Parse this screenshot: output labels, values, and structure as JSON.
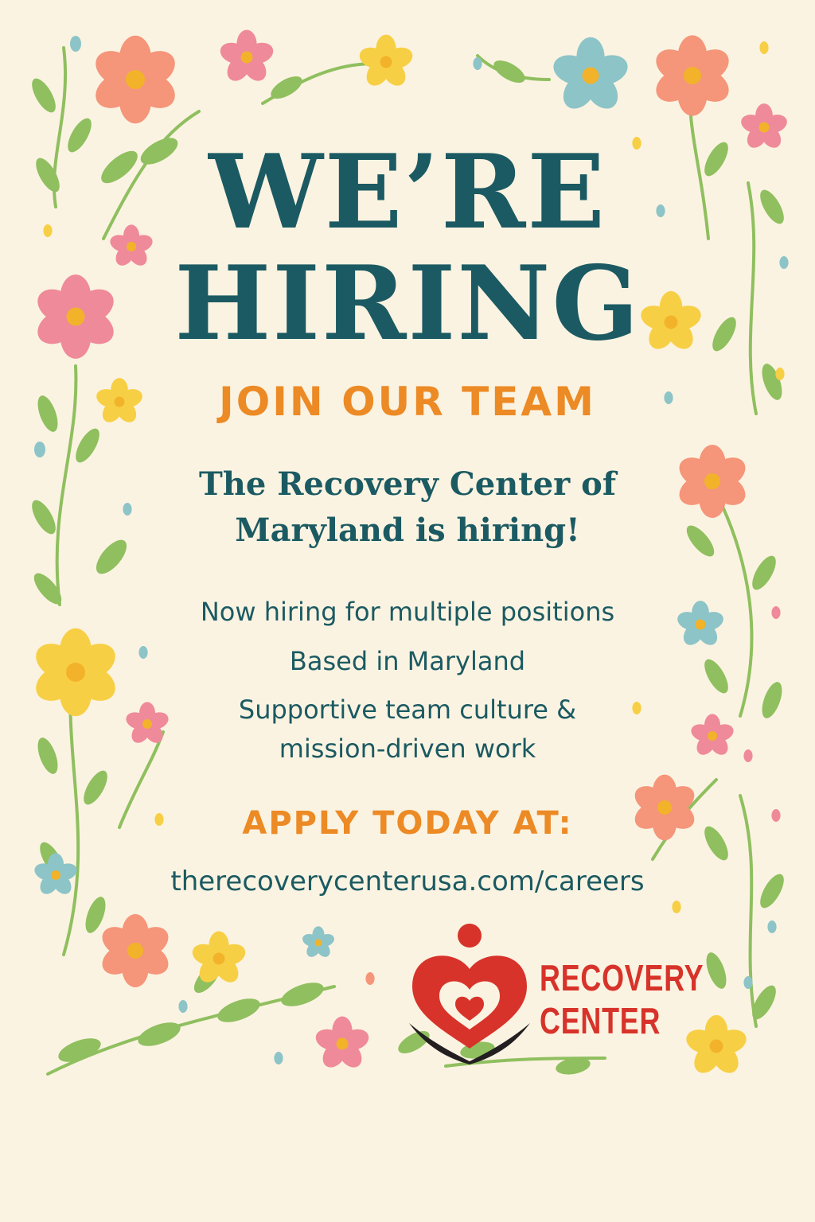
{
  "poster": {
    "headline_line1": "WE’RE",
    "headline_line2": "HIRING",
    "subheadline": "JOIN OUR TEAM",
    "intro_line1": "The Recovery Center of",
    "intro_line2": "Maryland is hiring!",
    "bullets": [
      "Now hiring for multiple positions",
      "Based in Maryland",
      "Supportive team culture &",
      "mission-driven work"
    ],
    "cta": "APPLY TODAY AT:",
    "url": "therecoverycenterusa.com/careers"
  },
  "logo": {
    "line1": "RECOVERY",
    "line2": "CENTER",
    "icon": "heart-person-icon"
  },
  "colors": {
    "background": "#fbf3e1",
    "teal": "#1b5a62",
    "orange": "#ec8a25",
    "logo_red": "#d7332a",
    "logo_black": "#231f20",
    "leaf": "#8fbf5f",
    "flower_pink": "#ef8a9a",
    "flower_coral": "#f5957a",
    "flower_yellow": "#f7cf45",
    "flower_blue": "#8cc4c8",
    "flower_center": "#f2b32a"
  },
  "decoration": {
    "border_icon": "floral-border-icon"
  }
}
